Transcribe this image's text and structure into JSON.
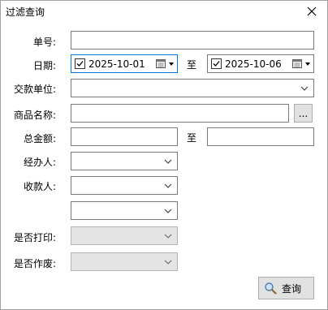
{
  "window": {
    "title": "过滤查询"
  },
  "labels": {
    "doc_no": "单号:",
    "date": "日期:",
    "payee_unit": "交款单位:",
    "product_name": "商品名称:",
    "total_amount": "总金额:",
    "handler": "经办人:",
    "receiver": "收款人:",
    "printed": "是否打印:",
    "voided": "是否作废:"
  },
  "fields": {
    "doc_no": "",
    "date_from": "2025-10-01",
    "date_to": "2025-10-06",
    "payee_unit": "",
    "product_name": "",
    "amount_from": "",
    "amount_to": "",
    "handler": "",
    "receiver": "",
    "extra": "",
    "printed": "",
    "voided": ""
  },
  "separators": {
    "to_date": "至",
    "to_amount": "至"
  },
  "buttons": {
    "browse": "...",
    "query": "查询"
  }
}
